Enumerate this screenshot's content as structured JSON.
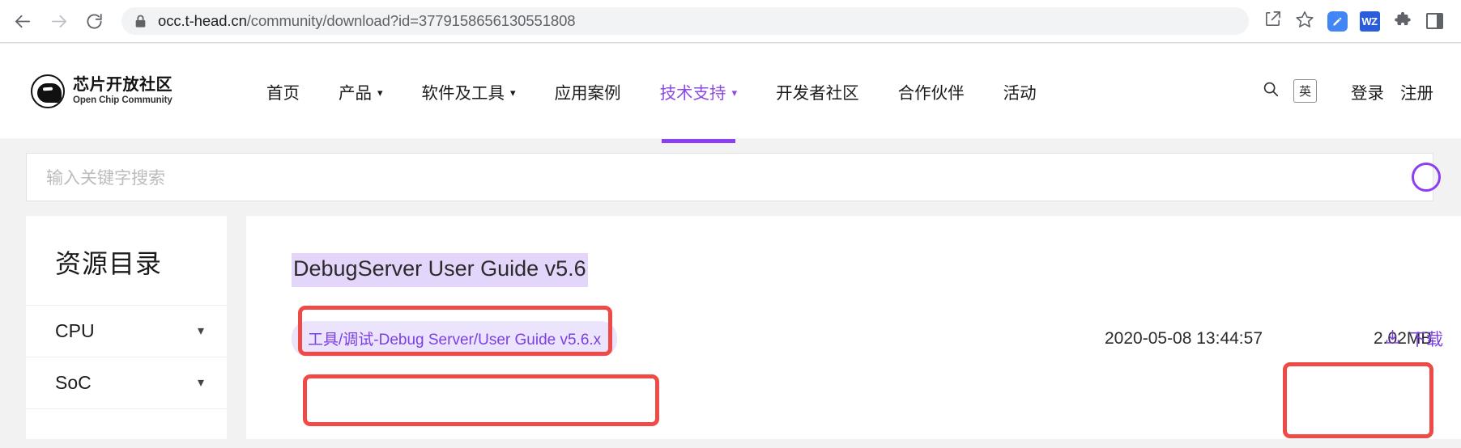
{
  "browser": {
    "url_host": "occ.t-head.cn",
    "url_path": "/community/download?id=3779158656130551808",
    "back_icon": "back-arrow-icon",
    "forward_icon": "forward-arrow-icon",
    "reload_icon": "reload-icon",
    "lock_icon": "lock-icon",
    "toolbar_icons": [
      "share-icon",
      "bookmark-star-icon",
      "pen-extension-icon",
      "wps-extension-icon",
      "extensions-puzzle-icon",
      "side-panel-icon"
    ],
    "wz_label": "WZ"
  },
  "site_header": {
    "logo_cn": "芯片开放社区",
    "logo_en": "Open Chip Community",
    "nav": [
      {
        "label": "首页",
        "has_caret": false,
        "active": false
      },
      {
        "label": "产品",
        "has_caret": true,
        "active": false
      },
      {
        "label": "软件及工具",
        "has_caret": true,
        "active": false
      },
      {
        "label": "应用案例",
        "has_caret": false,
        "active": false
      },
      {
        "label": "技术支持",
        "has_caret": true,
        "active": true
      },
      {
        "label": "开发者社区",
        "has_caret": false,
        "active": false
      },
      {
        "label": "合作伙伴",
        "has_caret": false,
        "active": false
      },
      {
        "label": "活动",
        "has_caret": false,
        "active": false
      }
    ],
    "search_icon": "search-icon",
    "language_toggle": "英",
    "login": "登录",
    "register": "注册",
    "active_color": "#8b3ff0"
  },
  "search": {
    "placeholder": "输入关键字搜索",
    "value": "",
    "submit_icon": "search-circle-icon"
  },
  "sidebar": {
    "title": "资源目录",
    "items": [
      {
        "label": "CPU",
        "chevron": "chevron-down-icon"
      },
      {
        "label": "SoC",
        "chevron": "chevron-down-icon"
      }
    ]
  },
  "content": {
    "doc_title": "DebugServer User Guide v5.6",
    "doc_title_highlight": "#e4d5fb",
    "file": {
      "tag": "工具/调试-Debug Server/User Guide v5.6.x",
      "date": "2020-05-08 13:44:57",
      "size": "2.02MB",
      "download_label": "下载",
      "download_icon": "download-arrow-icon",
      "accent": "#7b41e0"
    }
  },
  "annotations": {
    "color": "#f04a46",
    "boxes": [
      "doc-title-highlight-box",
      "file-tag-highlight-box",
      "download-button-highlight-box"
    ]
  }
}
